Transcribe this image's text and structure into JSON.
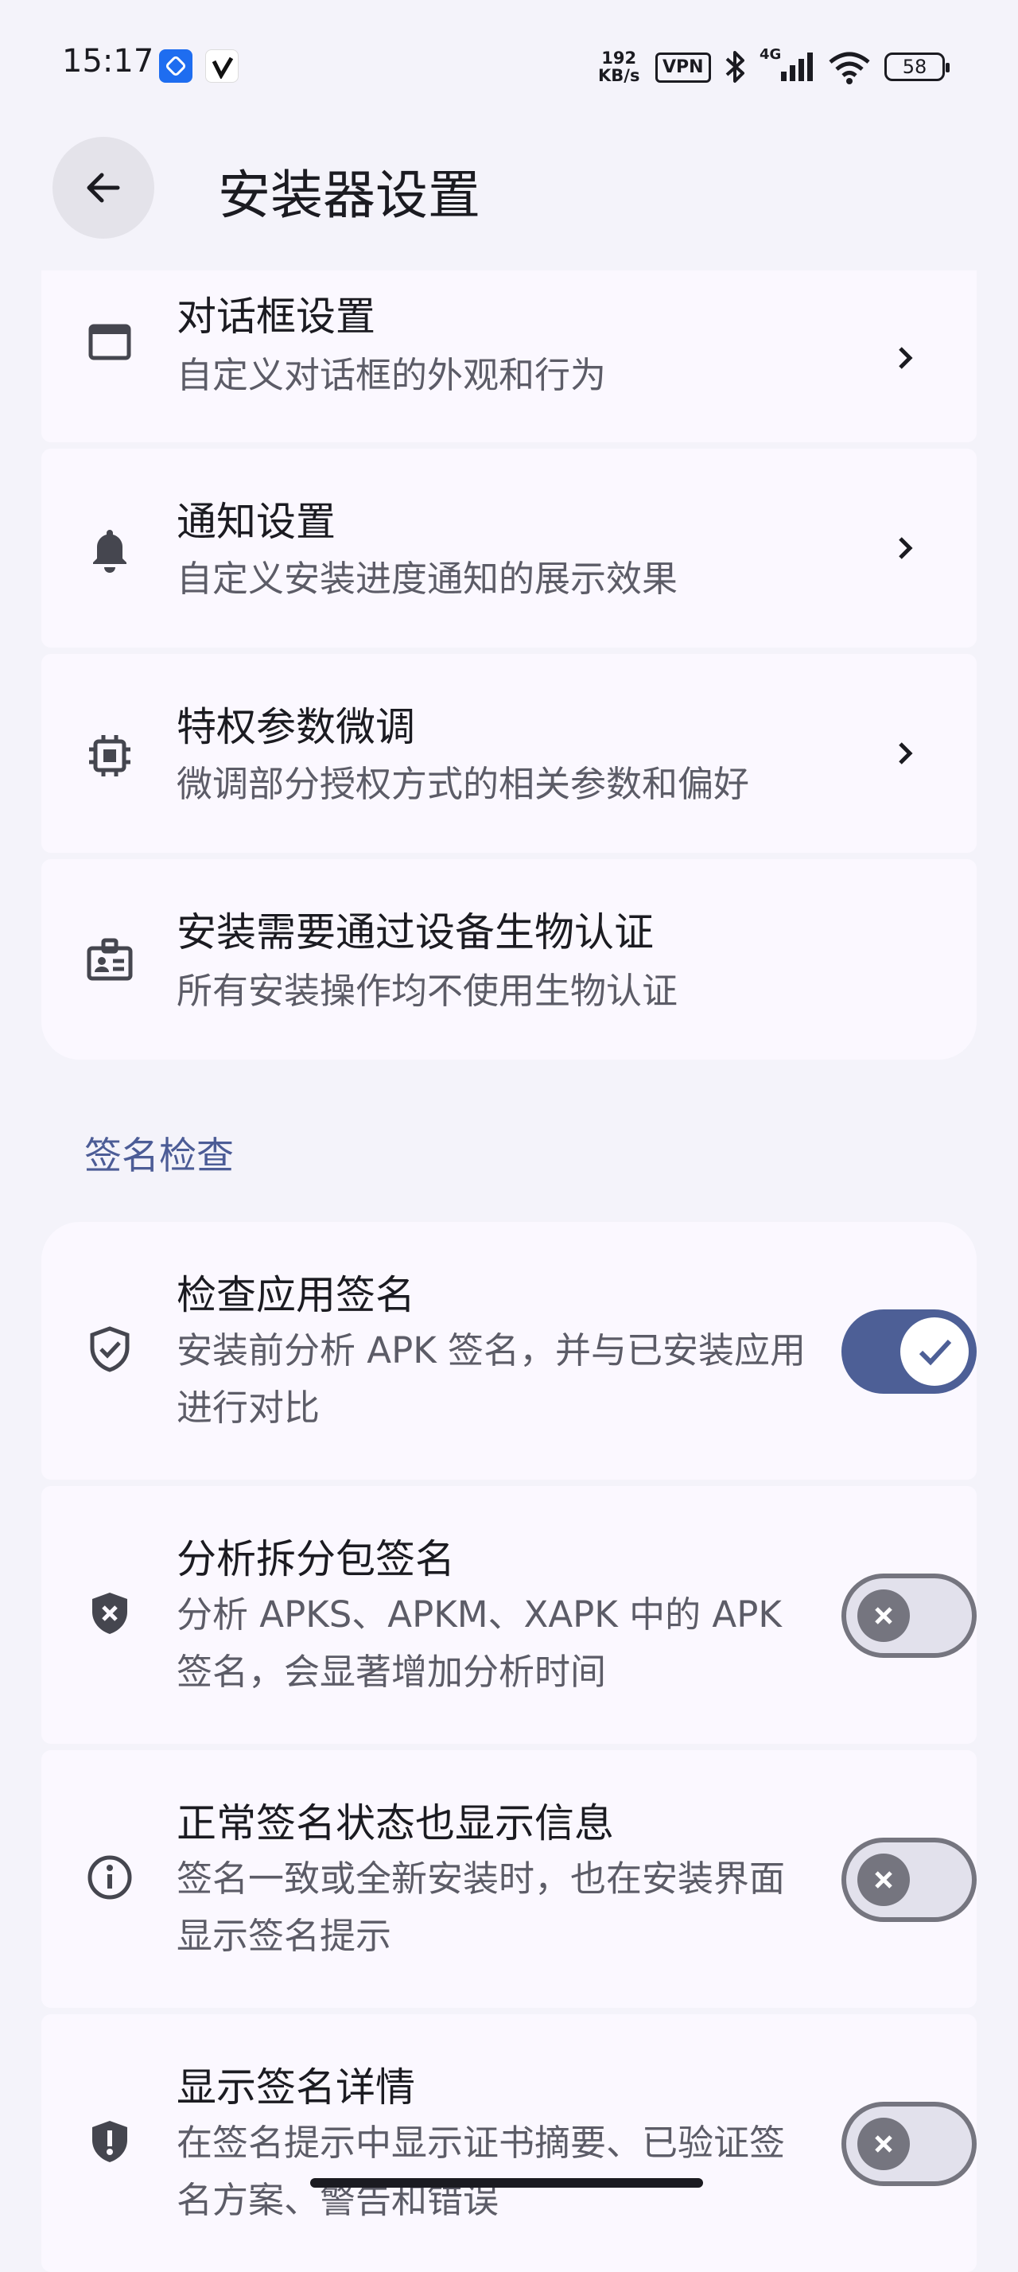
{
  "status_bar": {
    "time": "15:17",
    "net_speed_value": "192",
    "net_speed_unit": "KB/s",
    "vpn": "VPN",
    "signal_label": "4G",
    "battery": "58"
  },
  "header": {
    "title": "安装器设置",
    "back_icon": "arrow-back-icon"
  },
  "settings": [
    {
      "title": "对话框设置",
      "subtitle": "自定义对话框的外观和行为",
      "icon": "dialog-window-icon"
    },
    {
      "title": "通知设置",
      "subtitle": "自定义安装进度通知的展示效果",
      "icon": "bell-icon"
    },
    {
      "title": "特权参数微调",
      "subtitle": "微调部分授权方式的相关参数和偏好",
      "icon": "chip-icon"
    },
    {
      "title": "安装需要通过设备生物认证",
      "subtitle": "所有安装操作均不使用生物认证",
      "icon": "badge-id-icon"
    }
  ],
  "signature_section": {
    "title": "签名检查",
    "items": [
      {
        "title": "检查应用签名",
        "subtitle": "安装前分析 APK 签名，并与已安装应用进行对比",
        "enabled": true,
        "icon": "shield-check-icon"
      },
      {
        "title": "分析拆分包签名",
        "subtitle": "分析 APKS、APKM、XAPK 中的 APK 签名，会显著增加分析时间",
        "enabled": false,
        "icon": "shield-x-icon"
      },
      {
        "title": "正常签名状态也显示信息",
        "subtitle": "签名一致或全新安装时，也在安装界面显示签名提示",
        "enabled": false,
        "icon": "info-circle-icon"
      },
      {
        "title": "显示签名详情",
        "subtitle": "在签名提示中显示证书摘要、已验证签名方案、警告和错误",
        "enabled": false,
        "icon": "shield-alert-icon"
      }
    ]
  }
}
